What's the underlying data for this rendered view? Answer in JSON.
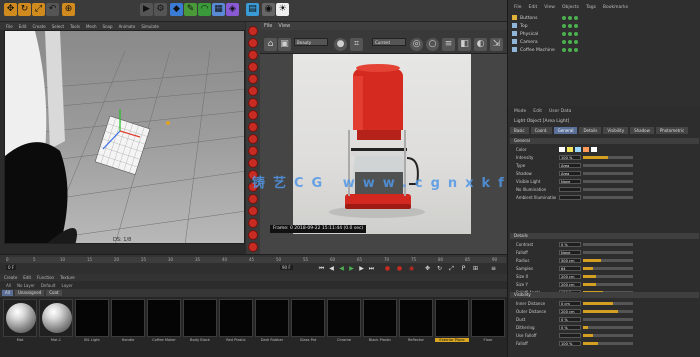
{
  "toolbar": {
    "icons": [
      "move-icon",
      "rotate-icon",
      "scale-icon",
      "undo-icon",
      "axis-icon",
      "render-icon",
      "render-settings-icon",
      "cube-icon",
      "pen-icon",
      "nurbs-icon",
      "array-icon",
      "deformer-icon",
      "scene-icon",
      "camera-icon",
      "light-icon"
    ]
  },
  "menubar": {
    "items": [
      "File",
      "Edit",
      "Create",
      "Select",
      "Tools",
      "Mesh",
      "Snap",
      "Animate",
      "Simulate"
    ]
  },
  "viewport": {
    "camera_label": "Default Camera",
    "corner_label": "DS: 1/8"
  },
  "render_view": {
    "menu": [
      "File",
      "View"
    ],
    "dropdown1": "Beauty",
    "dropdown2": "Current",
    "caption_prefix": "Frame: 0",
    "caption": "2018-09-22  15:11:44  (0.0 sec)",
    "watermark": "铸艺CG  www.cgnxkfb.cn"
  },
  "timeline": {
    "ticks": [
      "0",
      "5",
      "10",
      "15",
      "20",
      "25",
      "30",
      "35",
      "40",
      "45",
      "50",
      "55",
      "60",
      "65",
      "70",
      "75",
      "80",
      "85",
      "90"
    ],
    "current_frame": "0 F",
    "end_frame": "90 F"
  },
  "material_manager": {
    "menu": [
      "Create",
      "Edit",
      "Function",
      "Texture"
    ],
    "header": [
      "All",
      "No Layer",
      "Default",
      "Layer"
    ],
    "tabs": [
      "All",
      "Unassigned",
      "Coat"
    ],
    "materials": [
      {
        "name": "Mat",
        "type": "sphere"
      },
      {
        "name": "Mat.1",
        "type": "sphere"
      },
      {
        "name": "IBL Light",
        "type": "black"
      },
      {
        "name": "Handle",
        "type": "black"
      },
      {
        "name": "Coffee Maker",
        "type": "black"
      },
      {
        "name": "Body Black",
        "type": "black"
      },
      {
        "name": "Red Plastic",
        "type": "black"
      },
      {
        "name": "Dark Rubber",
        "type": "black"
      },
      {
        "name": "Glass Pot",
        "type": "black"
      },
      {
        "name": "Chrome",
        "type": "black"
      },
      {
        "name": "Black Plastic",
        "type": "black"
      },
      {
        "name": "Reflector",
        "type": "black"
      },
      {
        "name": "Exterior Plane",
        "type": "black",
        "selected": true
      },
      {
        "name": "Floor",
        "type": "black"
      }
    ]
  },
  "object_manager": {
    "menu": [
      "File",
      "Edit",
      "View",
      "Objects",
      "Tags",
      "Bookmarks"
    ],
    "objects": [
      {
        "name": "Buttons",
        "color": "#e0b23a"
      },
      {
        "name": "Top",
        "color": "#8fb6d9"
      },
      {
        "name": "Physical",
        "color": "#8fb6d9"
      },
      {
        "name": "Camera",
        "color": "#8fb6d9"
      },
      {
        "name": "Coffee Machine",
        "color": "#8fb6d9"
      }
    ]
  },
  "attribute_manager": {
    "menu": [
      "Mode",
      "Edit",
      "User Data"
    ],
    "title": "Light Object [Area Light]",
    "tabs": [
      "Basic",
      "Coord.",
      "General",
      "Details",
      "Visibility",
      "Shadow",
      "Photometric"
    ],
    "sections": {
      "general": "General",
      "details": "Details",
      "visibility": "Visibility"
    },
    "type_label": "Type",
    "type_value": "Area",
    "props": [
      {
        "label": "Color",
        "value": "",
        "type": "color"
      },
      {
        "label": "Intensity",
        "value": "100 %",
        "fill": 0.5
      },
      {
        "label": "Type",
        "value": "Area",
        "fill": 0
      },
      {
        "label": "Shadow",
        "value": "Area",
        "fill": 0
      },
      {
        "label": "Visible Light",
        "value": "None",
        "fill": 0
      },
      {
        "label": "No Illumination",
        "value": "",
        "fill": 0
      },
      {
        "label": "Ambient Illumination",
        "value": "",
        "fill": 0
      }
    ],
    "details": [
      {
        "label": "Contrast",
        "value": "0 %",
        "fill": 0
      },
      {
        "label": "Falloff",
        "value": "None",
        "fill": 0
      },
      {
        "label": "Radius",
        "value": "500 cm",
        "fill": 0.35
      },
      {
        "label": "Samples",
        "value": "64",
        "fill": 0.2
      },
      {
        "label": "Size X",
        "value": "200 cm",
        "fill": 0.25
      },
      {
        "label": "Size Y",
        "value": "200 cm",
        "fill": 0.25
      },
      {
        "label": "Falloff Angle",
        "value": "180 °",
        "fill": 0.4
      }
    ],
    "visibility": [
      {
        "label": "Inner Distance",
        "value": "0 cm",
        "fill": 0.6
      },
      {
        "label": "Outer Distance",
        "value": "200 cm",
        "fill": 0.7
      },
      {
        "label": "Dust",
        "value": "0 %",
        "fill": 0
      },
      {
        "label": "Dithering",
        "value": "0 %",
        "fill": 0.1
      },
      {
        "label": "Use Falloff",
        "value": "",
        "fill": 0.2
      },
      {
        "label": "Falloff",
        "value": "100 %",
        "fill": 0.3
      }
    ]
  },
  "colors": {
    "accent_orange": "#d4a021",
    "render_red": "#c82b22",
    "selected_tab": "#5b7099",
    "watermark_blue": "#5096e6"
  }
}
